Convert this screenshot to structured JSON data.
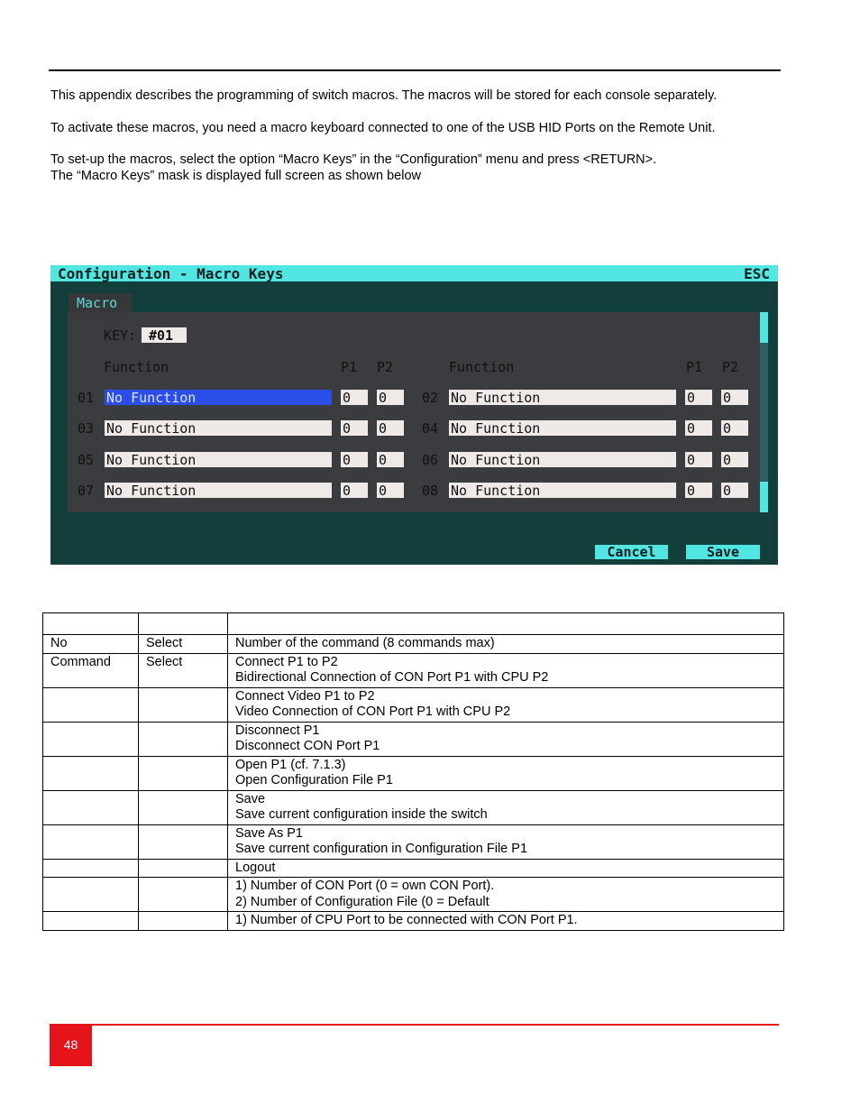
{
  "paragraphs": [
    "This appendix describes the programming of switch macros. The macros will be stored for each console separately.",
    "To activate these macros, you need a macro keyboard connected to one of the USB HID Ports on the Remote Unit.",
    "To set-up the macros, select the option “Macro Keys” in the “Configuration” menu and press <RETURN>.",
    "The “Macro Keys” mask is displayed full screen as shown below"
  ],
  "screen": {
    "title": "Configuration - Macro Keys",
    "esc": "ESC",
    "tab": "Macro",
    "key_label": "KEY:",
    "key_value": "#01",
    "col_function": "Function",
    "col_p1": "P1",
    "col_p2": "P2",
    "rows": [
      {
        "num": "01",
        "func": "No Function",
        "p1": "0",
        "p2": "0",
        "selected": true
      },
      {
        "num": "02",
        "func": "No Function",
        "p1": "0",
        "p2": "0"
      },
      {
        "num": "03",
        "func": "No Function",
        "p1": "0",
        "p2": "0"
      },
      {
        "num": "04",
        "func": "No Function",
        "p1": "0",
        "p2": "0"
      },
      {
        "num": "05",
        "func": "No Function",
        "p1": "0",
        "p2": "0"
      },
      {
        "num": "06",
        "func": "No Function",
        "p1": "0",
        "p2": "0"
      },
      {
        "num": "07",
        "func": "No Function",
        "p1": "0",
        "p2": "0"
      },
      {
        "num": "08",
        "func": "No Function",
        "p1": "0",
        "p2": "0"
      }
    ],
    "cancel": "Cancel",
    "save": "Save",
    "colors": {
      "titlebar": "#52e6e2",
      "selection": "#2b4de8",
      "background": "#123f3c"
    }
  },
  "table": {
    "rows": [
      [
        "",
        "",
        ""
      ],
      [
        "No",
        "Select",
        "Number of the command (8 commands max)"
      ],
      [
        "Command",
        "Select",
        "Connect P1 to P2\nBidirectional Connection of CON Port P1 with CPU P2"
      ],
      [
        "",
        "",
        "Connect Video P1 to P2\nVideo Connection of CON Port P1 with CPU P2"
      ],
      [
        "",
        "",
        "Disconnect P1\nDisconnect CON Port P1"
      ],
      [
        "",
        "",
        "Open P1 (cf. 7.1.3)\nOpen Configuration File P1"
      ],
      [
        "",
        "",
        "Save\nSave current configuration inside the switch"
      ],
      [
        "",
        "",
        "Save As P1\nSave current configuration in Configuration File P1"
      ],
      [
        "",
        "",
        "Logout"
      ],
      [
        "",
        "",
        "1) Number of CON Port (0 = own CON Port).\n2) Number of Configuration File (0 = Default"
      ],
      [
        "",
        "",
        "1) Number of CPU Port to be connected with CON Port P1."
      ]
    ]
  },
  "footer": {
    "page": "48"
  }
}
